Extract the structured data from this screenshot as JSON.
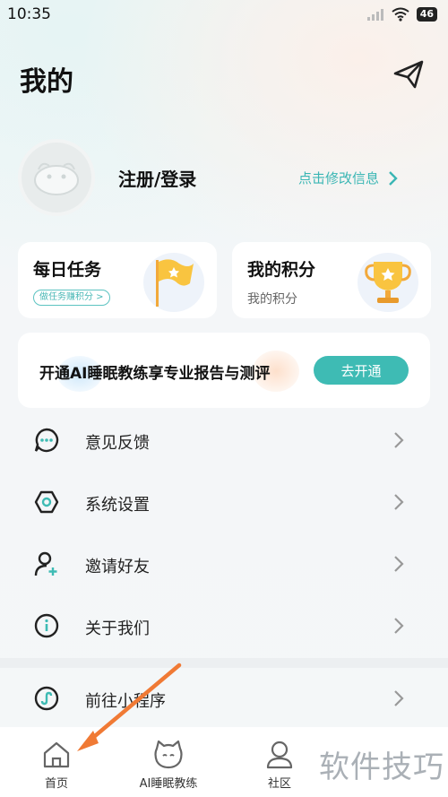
{
  "status_bar": {
    "time": "10:35",
    "battery": "46"
  },
  "header": {
    "title": "我的"
  },
  "profile": {
    "login_label": "注册/登录",
    "edit_label": "点击修改信息"
  },
  "cards": {
    "daily_task": {
      "title": "每日任务",
      "tag": "做任务赚积分 >"
    },
    "points": {
      "title": "我的积分",
      "subtitle": "我的积分"
    }
  },
  "promo": {
    "text": "开通AI睡眠教练享专业报告与测评",
    "button": "去开通"
  },
  "menu": [
    {
      "label": "意见反馈",
      "icon": "chat-bubble-icon"
    },
    {
      "label": "系统设置",
      "icon": "gear-icon"
    },
    {
      "label": "邀请好友",
      "icon": "add-user-icon"
    },
    {
      "label": "关于我们",
      "icon": "info-icon"
    },
    {
      "label": "前往小程序",
      "icon": "mini-program-icon"
    }
  ],
  "tabbar": [
    {
      "label": "首页",
      "icon": "home-icon"
    },
    {
      "label": "AI睡眠教练",
      "icon": "cat-face-icon"
    },
    {
      "label": "社区",
      "icon": "person-icon"
    }
  ],
  "watermark": "软件技巧",
  "colors": {
    "accent": "#3ebbb4",
    "annotation_arrow": "#f07a35"
  }
}
